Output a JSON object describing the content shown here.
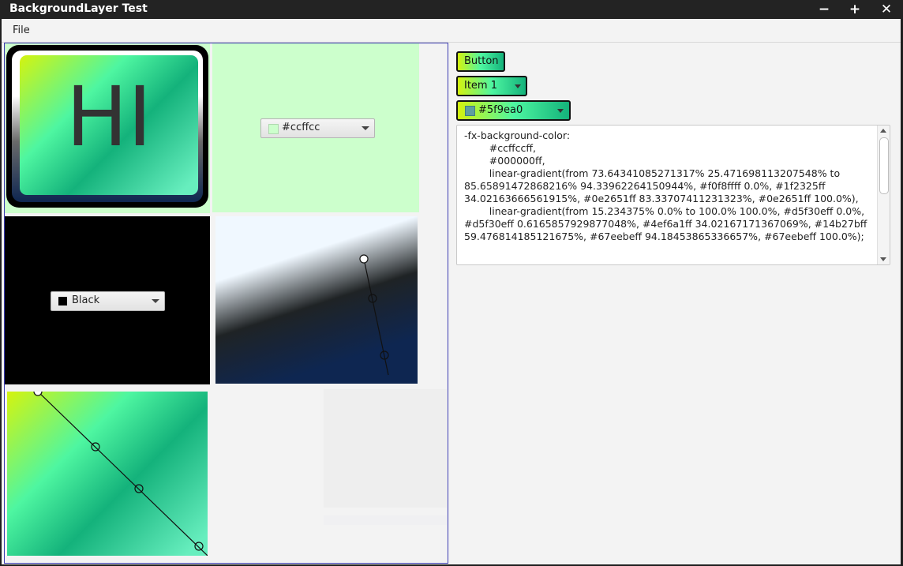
{
  "window": {
    "title": "BackgroundLayer Test",
    "controls": {
      "minimize": "−",
      "maximize": "+",
      "close": "✕"
    }
  },
  "menubar": {
    "file": "File"
  },
  "tiles": {
    "hi_label": "HI",
    "color_picker_1": {
      "value": "#ccffcc",
      "swatch": "#ccffcc"
    },
    "color_picker_2": {
      "value": "Black",
      "swatch": "#000000"
    }
  },
  "right_panel": {
    "button_label": "Button",
    "choice_value": "Item 1",
    "color_picker": {
      "value": "#5f9ea0",
      "swatch": "#5f9ea0"
    },
    "css_text": "-fx-background-color:\n        #ccffccff,\n        #000000ff,\n        linear-gradient(from 73.64341085271317% 25.471698113207548% to 85.65891472868216% 94.33962264150944%, #f0f8ffff 0.0%, #1f2325ff 34.02163666561915%, #0e2651ff 83.33707411231323%, #0e2651ff 100.0%),\n        linear-gradient(from 15.234375% 0.0% to 100.0% 100.0%, #d5f30eff 0.0%, #d5f30eff 0.6165857929877048%, #4ef6a1ff 34.02167171367069%, #14b27bff 59.476814185121675%, #67eebeff 94.18453865336657%, #67eebeff 100.0%);"
  },
  "colors": {
    "gradient_a": [
      "#d5f30e",
      "#4ef6a1",
      "#14b27b",
      "#67eebe"
    ],
    "gradient_b": [
      "#f0f8ff",
      "#1f2325",
      "#0e2651"
    ],
    "selection_border": "#3b3bb0"
  }
}
